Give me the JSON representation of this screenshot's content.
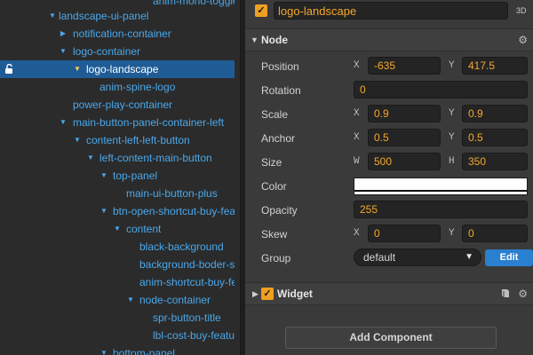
{
  "hierarchy": {
    "rows": [
      {
        "label": "anim-mono-toggle",
        "arrow": "",
        "selected": false
      },
      {
        "label": "landscape-ui-panel",
        "arrow": "down",
        "selected": false
      },
      {
        "label": "notification-container",
        "arrow": "right",
        "selected": false
      },
      {
        "label": "logo-container",
        "arrow": "down",
        "selected": false
      },
      {
        "label": "logo-landscape",
        "arrow": "down",
        "selected": true
      },
      {
        "label": "anim-spine-logo",
        "arrow": "",
        "selected": false
      },
      {
        "label": "power-play-container",
        "arrow": "",
        "selected": false
      },
      {
        "label": "main-button-panel-container-left",
        "arrow": "down",
        "selected": false
      },
      {
        "label": "content-left-left-button",
        "arrow": "down",
        "selected": false
      },
      {
        "label": "left-content-main-button",
        "arrow": "down",
        "selected": false
      },
      {
        "label": "top-panel",
        "arrow": "down",
        "selected": false
      },
      {
        "label": "main-ui-button-plus",
        "arrow": "",
        "selected": false
      },
      {
        "label": "btn-open-shortcut-buy-feature",
        "arrow": "down",
        "selected": false
      },
      {
        "label": "content",
        "arrow": "down",
        "selected": false
      },
      {
        "label": "black-background",
        "arrow": "",
        "selected": false
      },
      {
        "label": "background-boder-shortcut",
        "arrow": "",
        "selected": false
      },
      {
        "label": "anim-shortcut-buy-feature",
        "arrow": "",
        "selected": false
      },
      {
        "label": "node-container",
        "arrow": "down",
        "selected": false
      },
      {
        "label": "spr-button-title",
        "arrow": "",
        "selected": false
      },
      {
        "label": "lbl-cost-buy-feature",
        "arrow": "",
        "selected": false
      },
      {
        "label": "bottom-panel",
        "arrow": "down",
        "selected": false
      }
    ]
  },
  "inspector": {
    "node_name": "logo-landscape",
    "mode_label": "3D",
    "node_section": {
      "title": "Node"
    },
    "position": {
      "label": "Position",
      "x_axis": "X",
      "x": "-635",
      "y_axis": "Y",
      "y": "417.5"
    },
    "rotation": {
      "label": "Rotation",
      "value": "0"
    },
    "scale": {
      "label": "Scale",
      "x_axis": "X",
      "x": "0.9",
      "y_axis": "Y",
      "y": "0.9"
    },
    "anchor": {
      "label": "Anchor",
      "x_axis": "X",
      "x": "0.5",
      "y_axis": "Y",
      "y": "0.5"
    },
    "size": {
      "label": "Size",
      "w_axis": "W",
      "w": "500",
      "h_axis": "H",
      "h": "350"
    },
    "color": {
      "label": "Color",
      "value": "#ffffff"
    },
    "opacity": {
      "label": "Opacity",
      "value": "255"
    },
    "skew": {
      "label": "Skew",
      "x_axis": "X",
      "x": "0",
      "y_axis": "Y",
      "y": "0"
    },
    "group": {
      "label": "Group",
      "value": "default",
      "edit_label": "Edit"
    },
    "widget_section": {
      "title": "Widget"
    },
    "add_component_label": "Add Component"
  },
  "colors": {
    "accent": "#f5a82a",
    "selection": "#1f5c96",
    "tree_text": "#4aa8ec",
    "edit_button": "#2a7fce"
  }
}
